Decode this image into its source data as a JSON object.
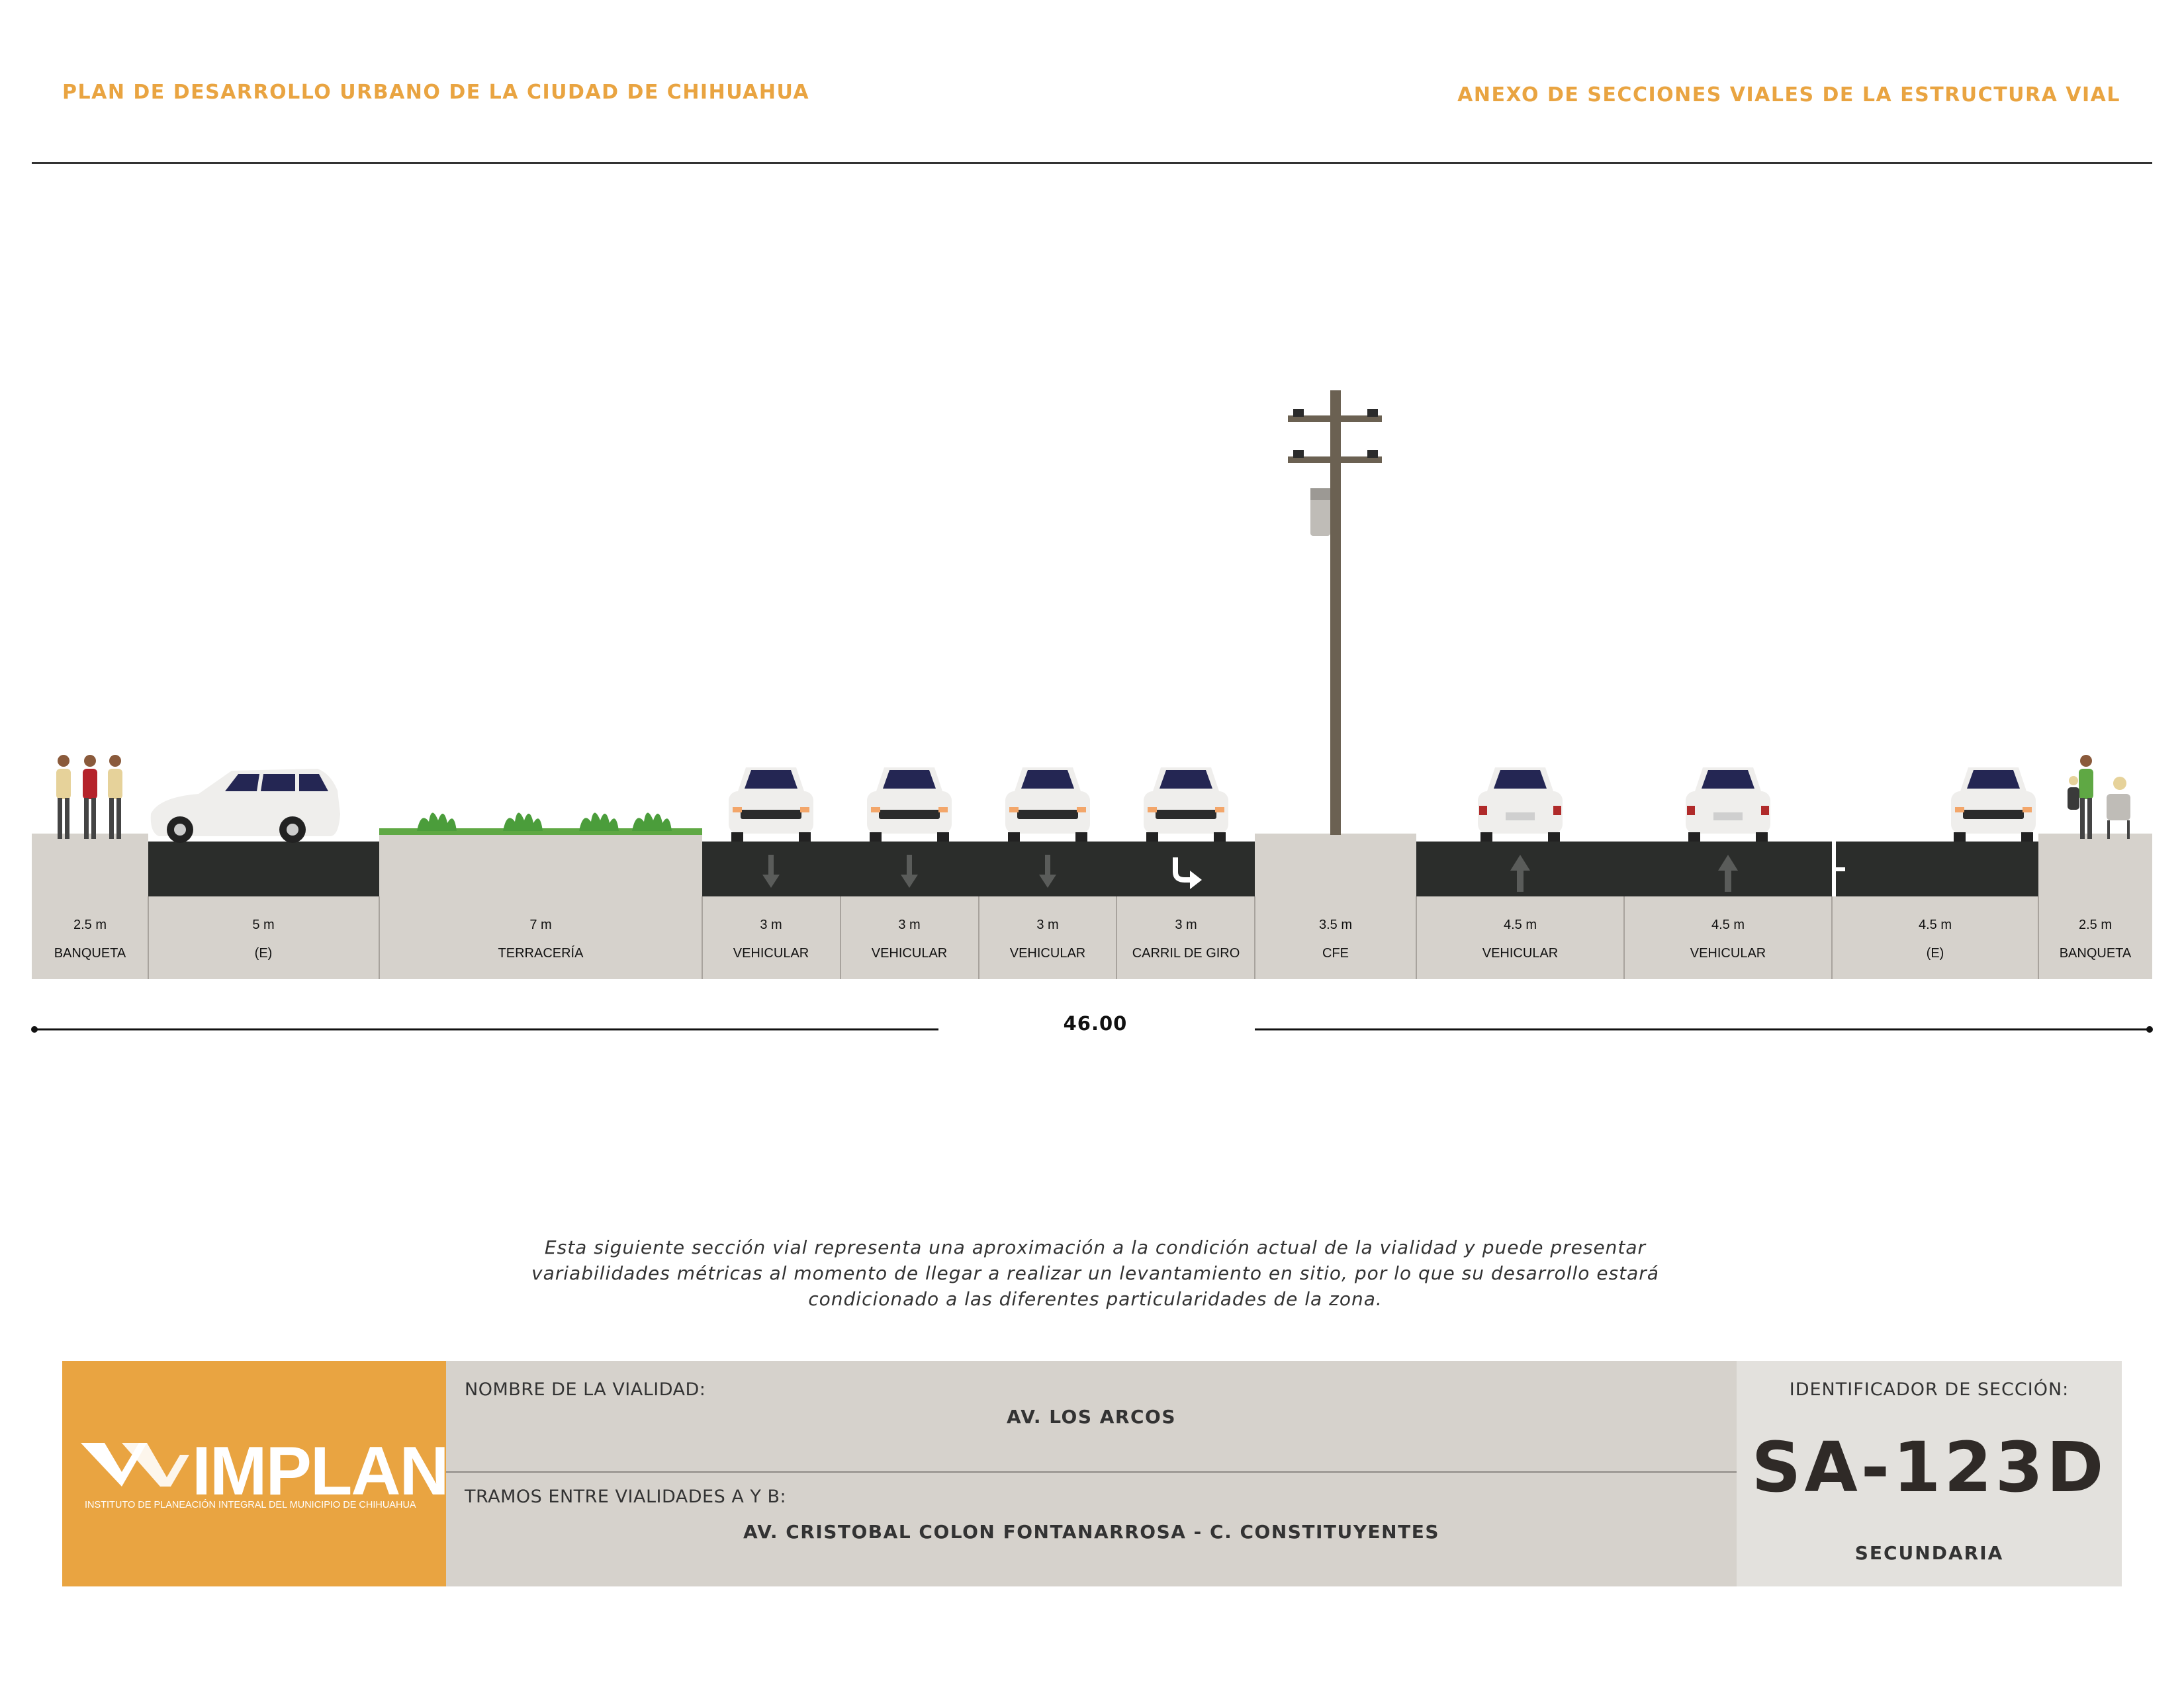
{
  "header": {
    "left_title": "PLAN DE DESARROLLO URBANO DE LA CIUDAD DE CHIHUAHUA",
    "right_title": "ANEXO DE SECCIONES VIALES DE LA ESTRUCTURA VIAL"
  },
  "segments": [
    {
      "width": "2.5 m",
      "type": "BANQUETA"
    },
    {
      "width": "5 m",
      "type": "(E)"
    },
    {
      "width": "7 m",
      "type": "TERRACERÍA"
    },
    {
      "width": "3 m",
      "type": "VEHICULAR"
    },
    {
      "width": "3 m",
      "type": "VEHICULAR"
    },
    {
      "width": "3 m",
      "type": "VEHICULAR"
    },
    {
      "width": "3 m",
      "type": "CARRIL DE GIRO"
    },
    {
      "width": "3.5 m",
      "type": "CFE"
    },
    {
      "width": "4.5 m",
      "type": "VEHICULAR"
    },
    {
      "width": "4.5 m",
      "type": "VEHICULAR"
    },
    {
      "width": "4.5 m",
      "type": "(E)"
    },
    {
      "width": "2.5 m",
      "type": "BANQUETA"
    }
  ],
  "total_width": "46.00",
  "disclaimer": {
    "line1": "Esta siguiente sección vial representa una aproximación a la condición actual de la vialidad y puede presentar",
    "line2": "variabilidades métricas al momento de llegar a realizar un levantamiento en sitio, por lo que su desarrollo estará",
    "line3": "condicionado a las diferentes particularidades de la zona."
  },
  "info": {
    "logo_text": "IMPLAN",
    "logo_subtitle": "INSTITUTO DE PLANEACIÓN INTEGRAL DEL MUNICIPIO DE CHIHUAHUA",
    "road_name_label": "NOMBRE DE LA VIALIDAD:",
    "road_name": "AV. LOS ARCOS",
    "segment_label": "TRAMOS ENTRE VIALIDADES A Y B:",
    "segment_value": "AV. CRISTOBAL COLON FONTANARROSA - C. CONSTITUYENTES",
    "id_label": "IDENTIFICADOR DE SECCIÓN:",
    "id_code": "SA-123D",
    "classification": "SECUNDARIA"
  },
  "colors": {
    "accent": "#e9a441",
    "pavement": "#2b2d2b",
    "sidewalk": "#d6d2cc",
    "panel": "#d6d2cc"
  }
}
